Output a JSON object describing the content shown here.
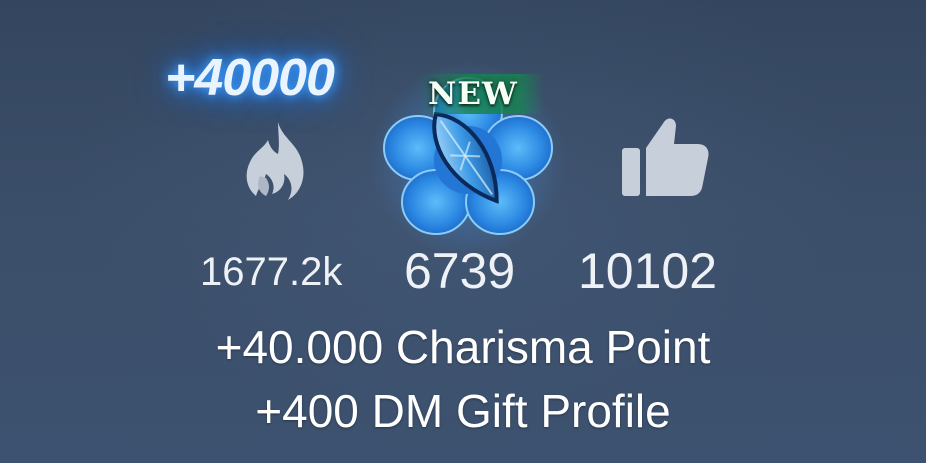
{
  "bonus": {
    "label": "+40000"
  },
  "badge": {
    "label": "NEW"
  },
  "stats": [
    {
      "icon": "fire-icon",
      "value": "1677.2k"
    },
    {
      "icon": "flower-gem-icon",
      "value": "6739"
    },
    {
      "icon": "thumbs-up-icon",
      "value": "10102"
    }
  ],
  "captions": {
    "line1": "+40.000 Charisma Point",
    "line2": "+400 DM Gift Profile"
  },
  "colors": {
    "background": "#3a4d67",
    "glow": "#2a87ff",
    "icon_gray": "#c9d0da",
    "badge_green": "#188250"
  }
}
